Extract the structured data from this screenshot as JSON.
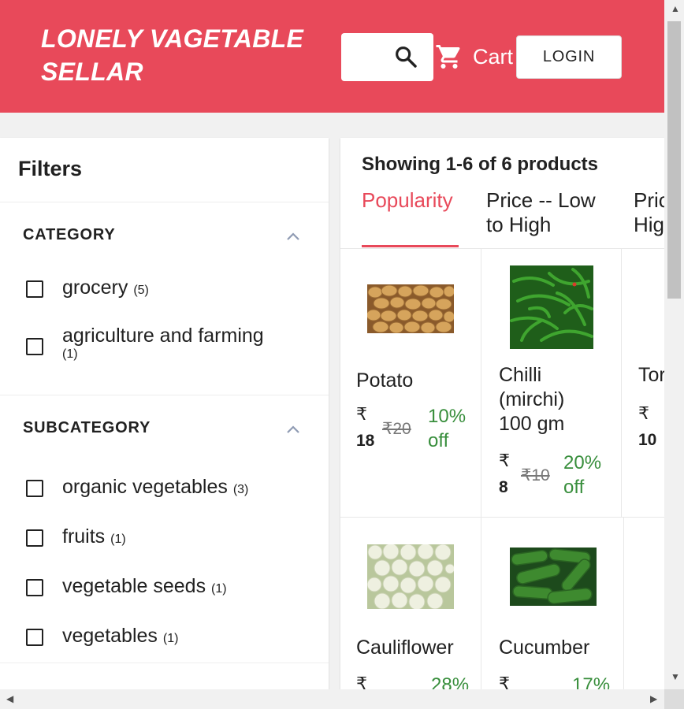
{
  "header": {
    "brand_line1": "LONELY VAGETABLE",
    "brand_line2": "SELLAR",
    "search_icon": "search-icon",
    "cart_label": "Cart",
    "cart_icon": "cart-icon",
    "login_label": "LOGIN",
    "brand_color": "#e8495a"
  },
  "filters": {
    "title": "Filters",
    "category": {
      "title": "CATEGORY",
      "options": [
        {
          "label": "grocery",
          "count": "(5)"
        },
        {
          "label": "agriculture and farming",
          "count": "(1)"
        }
      ]
    },
    "subcategory": {
      "title": "SUBCATEGORY",
      "options": [
        {
          "label": "organic vegetables",
          "count": "(3)"
        },
        {
          "label": "fruits",
          "count": "(1)"
        },
        {
          "label": "vegetable seeds",
          "count": "(1)"
        },
        {
          "label": "vegetables",
          "count": "(1)"
        }
      ]
    }
  },
  "results": {
    "title": "Showing 1-6 of 6 products",
    "tabs": [
      {
        "line1": "Popularity",
        "line2": ""
      },
      {
        "line1": "Price -- Low",
        "line2": "to High"
      },
      {
        "line1": "Pric",
        "line2": "Hig"
      }
    ],
    "currency": "₹",
    "products": [
      {
        "line1": "Potato",
        "line2": "",
        "line3": "",
        "price": "18",
        "mrp": "₹20",
        "off1": "10%",
        "off2": "off"
      },
      {
        "line1": "Chilli",
        "line2": "(mirchi)",
        "line3": "100 gm",
        "price": "8",
        "mrp": "₹10",
        "off1": "20%",
        "off2": "off"
      },
      {
        "line1": "Tor",
        "line2": "",
        "line3": "",
        "price": "10",
        "mrp": "",
        "off1": "",
        "off2": ""
      },
      {
        "line1": "Cauliflower",
        "line2": "",
        "line3": "",
        "price": "",
        "mrp": "",
        "off1": "28%",
        "off2": ""
      },
      {
        "line1": "Cucumber",
        "line2": "",
        "line3": "",
        "price": "",
        "mrp": "",
        "off1": "17%",
        "off2": ""
      }
    ],
    "accent_color": "#e8495a",
    "discount_color": "#388e3c"
  },
  "scrollbars": {
    "up_icon": "scroll-up-icon",
    "down_icon": "scroll-down-icon",
    "left_icon": "scroll-left-icon",
    "right_icon": "scroll-right-icon"
  }
}
